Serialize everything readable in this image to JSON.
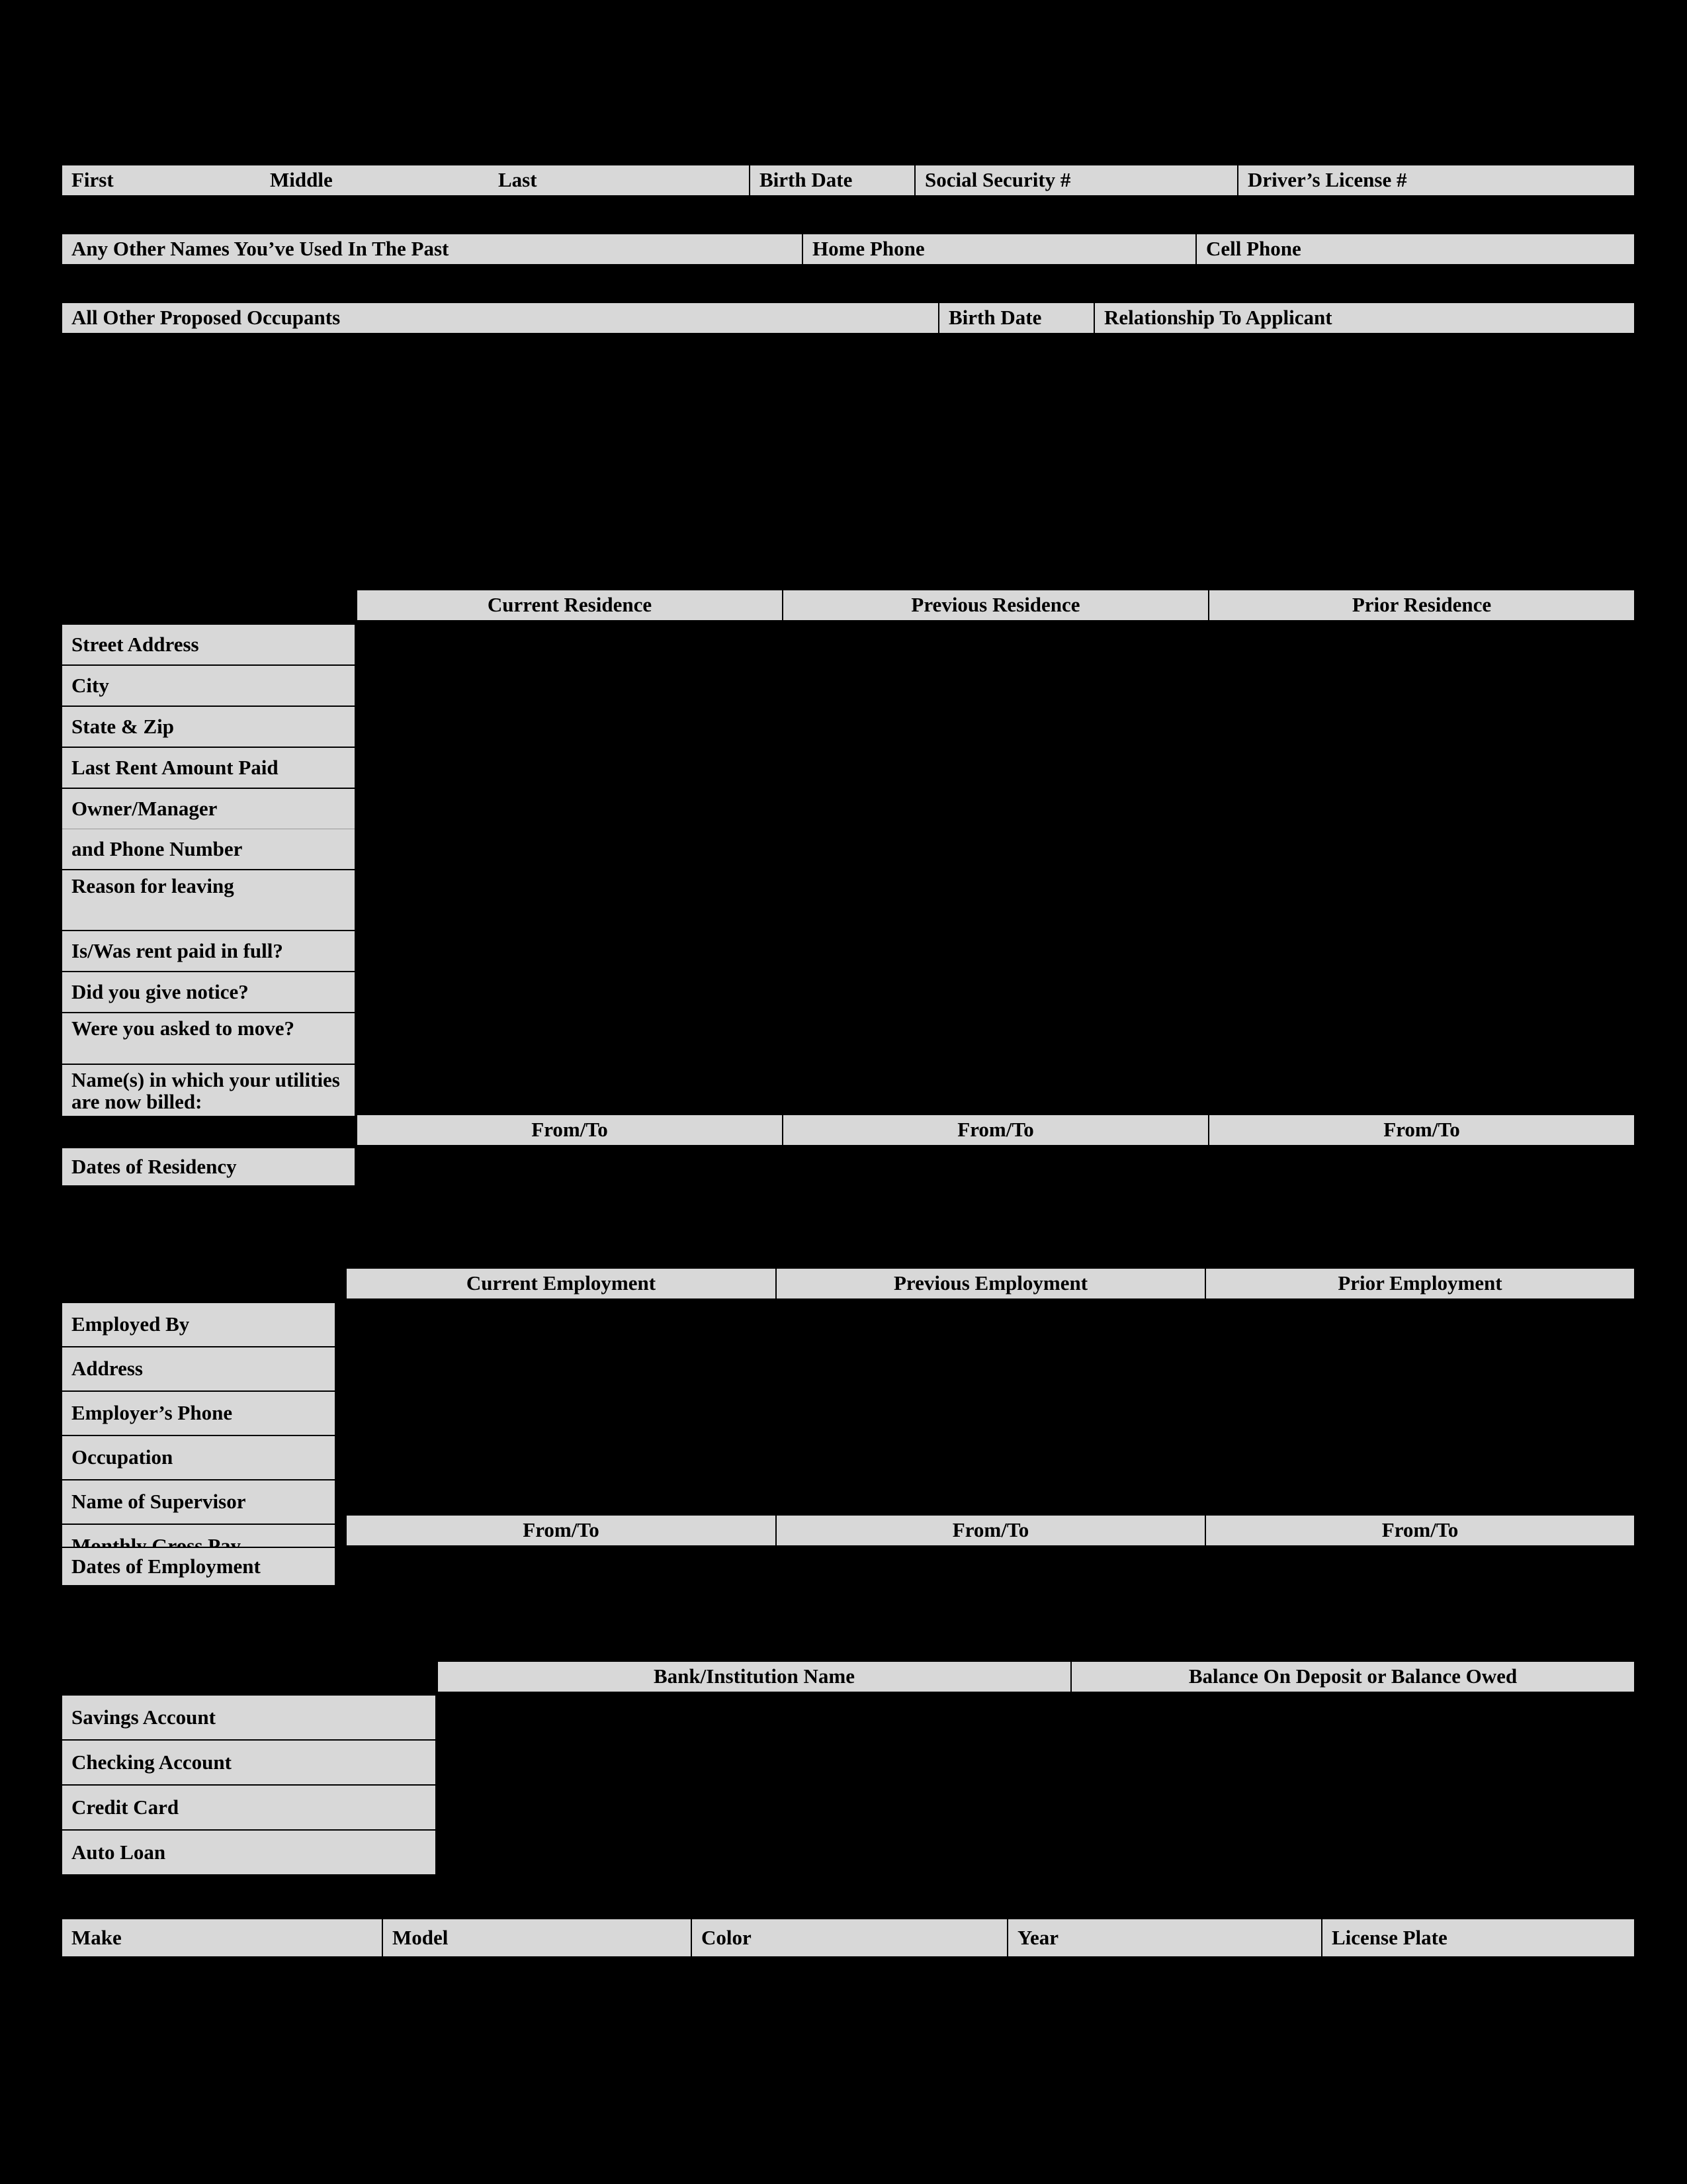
{
  "colors": {
    "page_background": "#000000",
    "cell_fill": "#d8d8d8",
    "text": "#000000",
    "border": "#000000"
  },
  "applicant_row": {
    "first_label": "First",
    "middle_label": "Middle",
    "last_label": "Last",
    "birth_date_label": "Birth Date",
    "social_security_label": "Social Security #",
    "drivers_license_label": "Driver’s License #"
  },
  "other_names_row": {
    "other_names_label": "Any Other Names You’ve Used In The Past",
    "home_phone_label": "Home Phone",
    "cell_phone_label": "Cell Phone"
  },
  "occupants_row": {
    "occupants_label": "All Other Proposed Occupants",
    "birth_date_label": "Birth Date",
    "relationship_label": "Relationship To Applicant"
  },
  "residence_section": {
    "columns": [
      "Current Residence",
      "Previous Residence",
      "Prior Residence"
    ],
    "rows": [
      "Street Address",
      "City",
      "State & Zip",
      "Last Rent Amount Paid",
      "Owner/Manager",
      "and Phone Number",
      "Reason for leaving",
      "Is/Was rent paid in full?",
      "Did you give notice?",
      "Were you asked to move?",
      "Name(s) in which your utilities are now billed:"
    ],
    "fromto_label": "From/To",
    "dates_label": "Dates of Residency"
  },
  "employment_section": {
    "columns": [
      "Current Employment",
      "Previous Employment",
      "Prior Employment"
    ],
    "rows": [
      "Employed By",
      "Address",
      "Employer’s Phone",
      "Occupation",
      "Name of Supervisor",
      "Monthly Gross Pay"
    ],
    "fromto_label": "From/To",
    "dates_label": "Dates of Employment"
  },
  "financial_section": {
    "columns": [
      "Bank/Institution Name",
      "Balance On Deposit or Balance Owed"
    ],
    "rows": [
      "Savings Account",
      "Checking Account",
      "Credit Card",
      "Auto Loan"
    ]
  },
  "vehicle_section": {
    "columns": [
      "Make",
      "Model",
      "Color",
      "Year",
      "License Plate"
    ]
  }
}
